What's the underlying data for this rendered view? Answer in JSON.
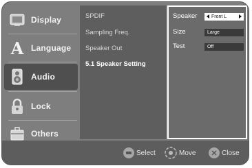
{
  "menu": {
    "items": [
      {
        "label": "Display",
        "icon": "display-icon"
      },
      {
        "label": "Language",
        "icon": "language-icon"
      },
      {
        "label": "Audio",
        "icon": "audio-icon"
      },
      {
        "label": "Lock",
        "icon": "lock-icon"
      },
      {
        "label": "Others",
        "icon": "others-icon"
      }
    ],
    "selected": "Audio"
  },
  "submenu": {
    "items": [
      "SPDIF",
      "Sampling Freq.",
      "Speaker Out",
      "5.1 Speaker Setting"
    ],
    "highlighted": "5.1 Speaker Setting"
  },
  "settings": {
    "speaker": {
      "label": "Speaker",
      "value": "Front L"
    },
    "size": {
      "label": "Size",
      "value": "Large"
    },
    "test": {
      "label": "Test",
      "value": "Off"
    }
  },
  "footer": {
    "select": "Select",
    "move": "Move",
    "close": "Close"
  }
}
